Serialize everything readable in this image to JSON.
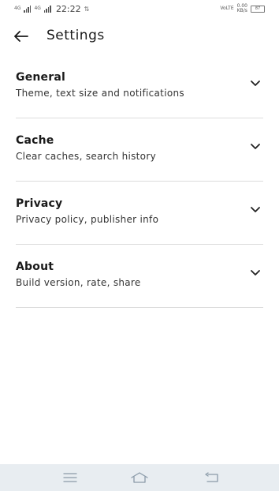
{
  "status_bar": {
    "net1": "4G",
    "net2": "4G",
    "time": "22:22",
    "volte": "VoLTE",
    "speed_value": "0.00",
    "speed_unit": "KB/s",
    "battery": "87"
  },
  "header": {
    "title": "Settings",
    "back_icon": "arrow-left-icon"
  },
  "settings": {
    "items": [
      {
        "title": "General",
        "subtitle": "Theme, text size and notifications"
      },
      {
        "title": "Cache",
        "subtitle": "Clear caches, search history"
      },
      {
        "title": "Privacy",
        "subtitle": "Privacy policy, publisher info"
      },
      {
        "title": "About",
        "subtitle": "Build version, rate, share"
      }
    ],
    "expand_icon": "chevron-down-icon"
  },
  "nav_bar": {
    "menu_icon": "menu-icon",
    "home_icon": "home-icon",
    "back_icon": "back-icon",
    "background": "#e8edf1"
  }
}
